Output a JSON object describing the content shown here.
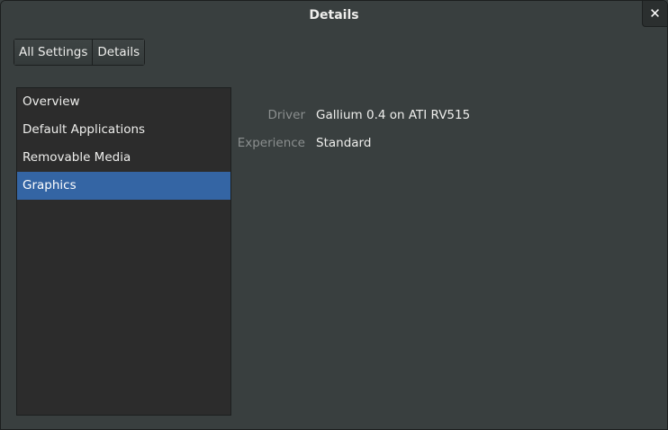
{
  "window": {
    "title": "Details",
    "close_glyph": "✕"
  },
  "pathbar": {
    "items": [
      {
        "label": "All Settings"
      },
      {
        "label": "Details"
      }
    ]
  },
  "sidebar": {
    "items": [
      {
        "label": "Overview",
        "selected": false
      },
      {
        "label": "Default Applications",
        "selected": false
      },
      {
        "label": "Removable Media",
        "selected": false
      },
      {
        "label": "Graphics",
        "selected": true
      }
    ]
  },
  "details": {
    "rows": [
      {
        "label": "Driver",
        "value": "Gallium 0.4 on ATI RV515"
      },
      {
        "label": "Experience",
        "value": "Standard"
      }
    ]
  },
  "colors": {
    "background": "#393f3f",
    "sidebar_bg": "#2c2c2c",
    "selection": "#3465a4",
    "text": "#eeeeec",
    "label_text": "#8b8f8f"
  }
}
